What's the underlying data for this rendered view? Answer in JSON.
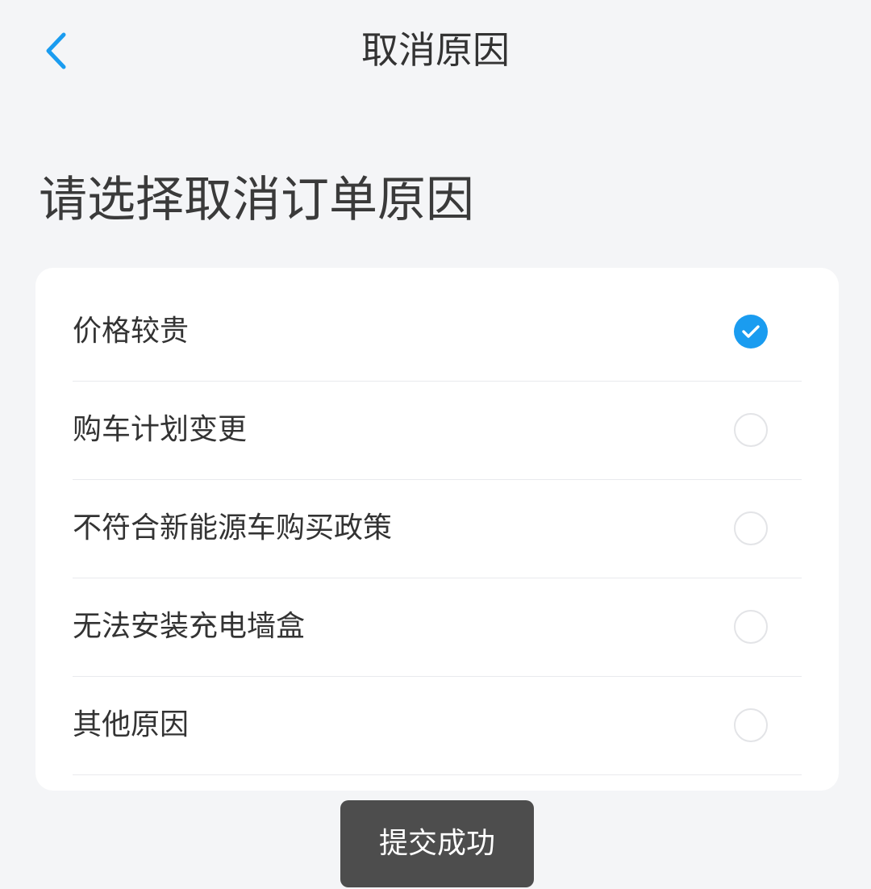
{
  "nav": {
    "title": "取消原因",
    "back_icon": "chevron-left-icon"
  },
  "heading": "请选择取消订单原因",
  "reasons": [
    {
      "label": "价格较贵",
      "selected": true
    },
    {
      "label": "购车计划变更",
      "selected": false
    },
    {
      "label": "不符合新能源车购买政策",
      "selected": false
    },
    {
      "label": "无法安装充电墙盒",
      "selected": false
    },
    {
      "label": "其他原因",
      "selected": false
    }
  ],
  "toast": {
    "text": "提交成功"
  },
  "colors": {
    "accent": "#1a9cf0",
    "background": "#f4f5f7",
    "card": "#ffffff",
    "toast_bg": "#4d4d4d"
  }
}
